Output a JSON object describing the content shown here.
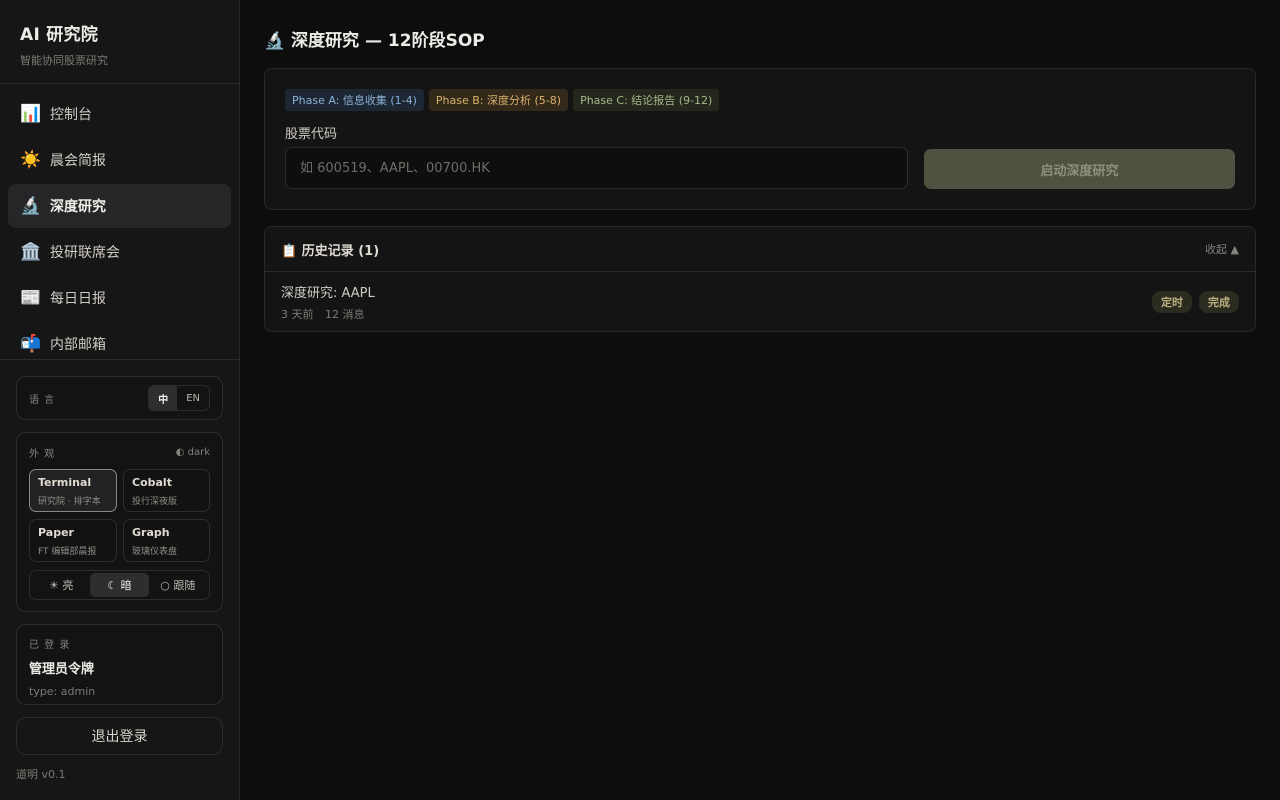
{
  "sidebar": {
    "brand_title": "AI 研究院",
    "brand_subtitle": "智能协同股票研究",
    "nav": [
      {
        "icon": "📊",
        "icon_name": "bar-chart-icon",
        "label": "控制台"
      },
      {
        "icon": "☀️",
        "icon_name": "sun-icon",
        "label": "晨会简报"
      },
      {
        "icon": "🔬",
        "icon_name": "microscope-icon",
        "label": "深度研究",
        "active": true
      },
      {
        "icon": "🏛️",
        "icon_name": "institution-icon",
        "label": "投研联席会"
      },
      {
        "icon": "📰",
        "icon_name": "newspaper-icon",
        "label": "每日日报"
      },
      {
        "icon": "📬",
        "icon_name": "mailbox-icon",
        "label": "内部邮箱"
      }
    ],
    "language": {
      "label": "语 言",
      "options": [
        "中",
        "EN"
      ],
      "selected": "中"
    },
    "appearance": {
      "label": "外 观",
      "mode_tag": "◐ dark",
      "themes": [
        {
          "name": "Terminal",
          "desc": "研究院 · 排字本",
          "selected": true
        },
        {
          "name": "Cobalt",
          "desc": "投行深夜版"
        },
        {
          "name": "Paper",
          "desc": "FT 编辑部晨报"
        },
        {
          "name": "Graph",
          "desc": "玻璃仪表盘"
        }
      ],
      "modes": [
        {
          "label": "☀ 亮"
        },
        {
          "label": "☾ 暗",
          "selected": true
        },
        {
          "label": "○ 跟随"
        }
      ]
    },
    "login": {
      "label": "已 登 录",
      "name": "管理员令牌",
      "type": "type: admin"
    },
    "logout_label": "退出登录",
    "version": "道明 v0.1"
  },
  "main": {
    "title_icon": "🔬",
    "title": "深度研究 — 12阶段SOP",
    "phases": [
      "Phase A: 信息收集 (1-4)",
      "Phase B: 深度分析 (5-8)",
      "Phase C: 结论报告 (9-12)"
    ],
    "ticker_label": "股票代码",
    "ticker_value": "",
    "ticker_placeholder": "如 600519、AAPL、00700.HK",
    "start_button": "启动深度研究",
    "history": {
      "icon": "📋",
      "title": "历史记录 (1)",
      "collapse_label": "收起 ▲",
      "items": [
        {
          "title": "深度研究: AAPL",
          "time": "3 天前",
          "messages": "12 消息",
          "badges": [
            "定时",
            "完成"
          ]
        }
      ]
    }
  },
  "colors": {
    "background": "#0d0d0e",
    "sidebar": "#161617",
    "accent_button": "#4e5240",
    "phase_a": "#8cb0d4",
    "phase_b": "#d8b06a",
    "phase_c": "#a9b48a"
  }
}
